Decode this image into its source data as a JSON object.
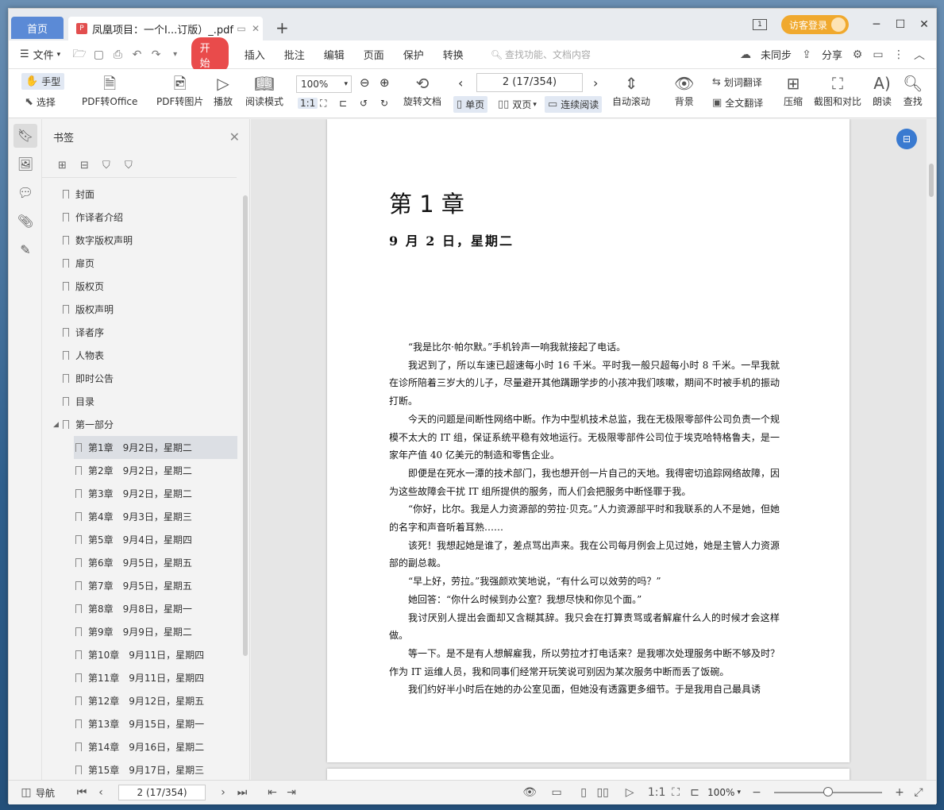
{
  "titlebar": {
    "home_tab": "首页",
    "doc_tab_title": "凤凰项目：一个I...订版）_.pdf",
    "new_tab": "+",
    "login_label": "访客登录"
  },
  "menubar": {
    "file": "文件",
    "start": "开始",
    "items": [
      "插入",
      "批注",
      "编辑",
      "页面",
      "保护",
      "转换"
    ],
    "search_placeholder": "查找功能、文档内容",
    "unsync": "未同步",
    "share": "分享"
  },
  "ribbon": {
    "hand": "手型",
    "select": "选择",
    "pdf_to_office": "PDF转Office",
    "pdf_to_image": "PDF转图片",
    "play": "播放",
    "read_mode": "阅读模式",
    "zoom": "100%",
    "rotate_doc": "旋转文档",
    "page_indicator": "2 (17/354)",
    "single_page": "单页",
    "double_page": "双页",
    "continuous_read": "连续阅读",
    "auto_scroll": "自动滚动",
    "background": "背景",
    "word_translate": "划词翻译",
    "full_translate": "全文翻译",
    "compress": "压缩",
    "screenshot_compare": "截图和对比",
    "read_aloud": "朗读",
    "find": "查找"
  },
  "sidebar": {
    "title": "书签",
    "bookmarks_top": [
      "封面",
      "作译者介绍",
      "数字版权声明",
      "扉页",
      "版权页",
      "版权声明",
      "译者序",
      "人物表",
      "即时公告",
      "目录"
    ],
    "part": "第一部分",
    "chapters": [
      "第1章　9月2日，星期二",
      "第2章　9月2日，星期二",
      "第3章　9月2日，星期二",
      "第4章　9月3日，星期三",
      "第5章　9月4日，星期四",
      "第6章　9月5日，星期五",
      "第7章　9月5日，星期五",
      "第8章　9月8日，星期一",
      "第9章　9月9日，星期二",
      "第10章　9月11日，星期四",
      "第11章　9月11日，星期四",
      "第12章　9月12日，星期五",
      "第13章　9月15日，星期一",
      "第14章　9月16日，星期二",
      "第15章　9月17日，星期三"
    ]
  },
  "document": {
    "chapter_title": "第 1 章",
    "date_line": "9 月 2 日，星期二",
    "paragraphs": [
      "“我是比尔·帕尔默。”手机铃声一响我就接起了电话。",
      "我迟到了，所以车速已超速每小时 16 千米。平时我一般只超每小时 8 千米。一早我就在诊所陪着三岁大的儿子，尽量避开其他蹒跚学步的小孩冲我们咳嗽，期间不时被手机的振动打断。",
      "今天的问题是间断性网络中断。作为中型机技术总监，我在无极限零部件公司负责一个规模不太大的 IT 组，保证系统平稳有效地运行。无极限零部件公司位于埃克哈特格鲁夫，是一家年产值 40 亿美元的制造和零售企业。",
      "即便是在死水一潭的技术部门，我也想开创一片自己的天地。我得密切追踪网络故障，因为这些故障会干扰 IT 组所提供的服务，而人们会把服务中断怪罪于我。",
      "“你好，比尔。我是人力资源部的劳拉·贝克。”人力资源部平时和我联系的人不是她，但她的名字和声音听着耳熟……",
      "该死！我想起她是谁了，差点骂出声来。我在公司每月例会上见过她，她是主管人力资源部的副总裁。",
      "“早上好，劳拉。”我强颜欢笑地说，“有什么可以效劳的吗？”",
      "她回答：“你什么时候到办公室？我想尽快和你见个面。”",
      "我讨厌别人提出会面却又含糊其辞。我只会在打算责骂或者解雇什么人的时候才会这样做。",
      "等一下。是不是有人想解雇我，所以劳拉才打电话来？是我哪次处理服务中断不够及时？作为 IT 运维人员，我和同事们经常开玩笑说可别因为某次服务中断而丢了饭碗。",
      "我们约好半小时后在她的办公室见面，但她没有透露更多细节。于是我用自己最具诱"
    ]
  },
  "statusbar": {
    "nav": "导航",
    "page_indicator": "2 (17/354)",
    "zoom": "100%"
  }
}
